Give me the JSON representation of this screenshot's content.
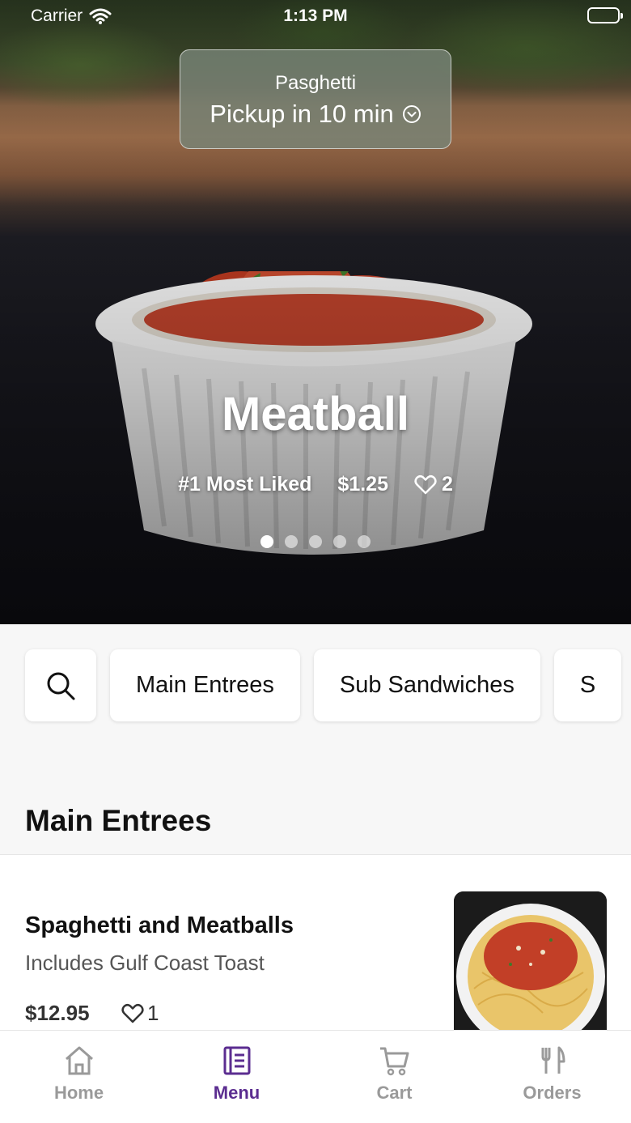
{
  "status_bar": {
    "carrier": "Carrier",
    "time": "1:13 PM"
  },
  "store": {
    "name": "Pasghetti",
    "pickup": "Pickup in 10 min"
  },
  "featured": {
    "title": "Meatball",
    "rank": "#1 Most Liked",
    "price": "$1.25",
    "likes": "2",
    "slide_count": 5,
    "active_slide": 1
  },
  "categories": {
    "items": [
      "Main Entrees",
      "Sub Sandwiches",
      "S"
    ]
  },
  "section": {
    "title": "Main Entrees"
  },
  "menu_items": [
    {
      "name": "Spaghetti and Meatballs",
      "description": "Includes Gulf Coast Toast",
      "price": "$12.95",
      "likes": "1"
    }
  ],
  "tabs": [
    {
      "label": "Home",
      "icon": "home-icon",
      "active": false
    },
    {
      "label": "Menu",
      "icon": "menu-icon",
      "active": true
    },
    {
      "label": "Cart",
      "icon": "cart-icon",
      "active": false
    },
    {
      "label": "Orders",
      "icon": "utensils-icon",
      "active": false
    }
  ],
  "colors": {
    "accent": "#5b2d90",
    "inactive_tab": "#9a9a9a"
  }
}
